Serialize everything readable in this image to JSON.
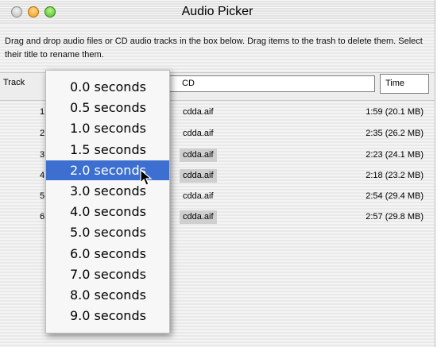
{
  "window": {
    "title": "Audio Picker",
    "controls": [
      "close-icon",
      "minimize-icon",
      "zoom-icon"
    ]
  },
  "instructions": "Drag and drop audio files or CD audio tracks in the box below. Drag items to the trash to delete them. Select their title to rename them.",
  "table": {
    "track_header": "Track",
    "cd_title": "CD",
    "time_header": "Time",
    "rows": [
      {
        "num": "1",
        "file": "cdda.aif",
        "time": "1:59 (20.1 MB)",
        "highlighted": false
      },
      {
        "num": "2",
        "file": "cdda.aif",
        "time": "2:35 (26.2 MB)",
        "highlighted": false
      },
      {
        "num": "3",
        "file": "cdda.aif",
        "time": "2:23 (24.1 MB)",
        "highlighted": true
      },
      {
        "num": "4",
        "file": "cdda.aif",
        "time": "2:18 (23.2 MB)",
        "highlighted": true
      },
      {
        "num": "5",
        "file": "cdda.aif",
        "time": "2:54 (29.4 MB)",
        "highlighted": false
      },
      {
        "num": "6",
        "file": "cdda.aif",
        "time": "2:57 (29.8 MB)",
        "highlighted": true
      }
    ]
  },
  "popup_menu": {
    "items": [
      "0.0 seconds",
      "0.5 seconds",
      "1.0 seconds",
      "1.5 seconds",
      "2.0 seconds",
      "3.0 seconds",
      "4.0 seconds",
      "5.0 seconds",
      "6.0 seconds",
      "7.0 seconds",
      "8.0 seconds",
      "9.0 seconds"
    ],
    "selected": "2.0 seconds"
  },
  "colors": {
    "selection": "#3c6fcf",
    "row_highlight": "#cfcfcf"
  }
}
